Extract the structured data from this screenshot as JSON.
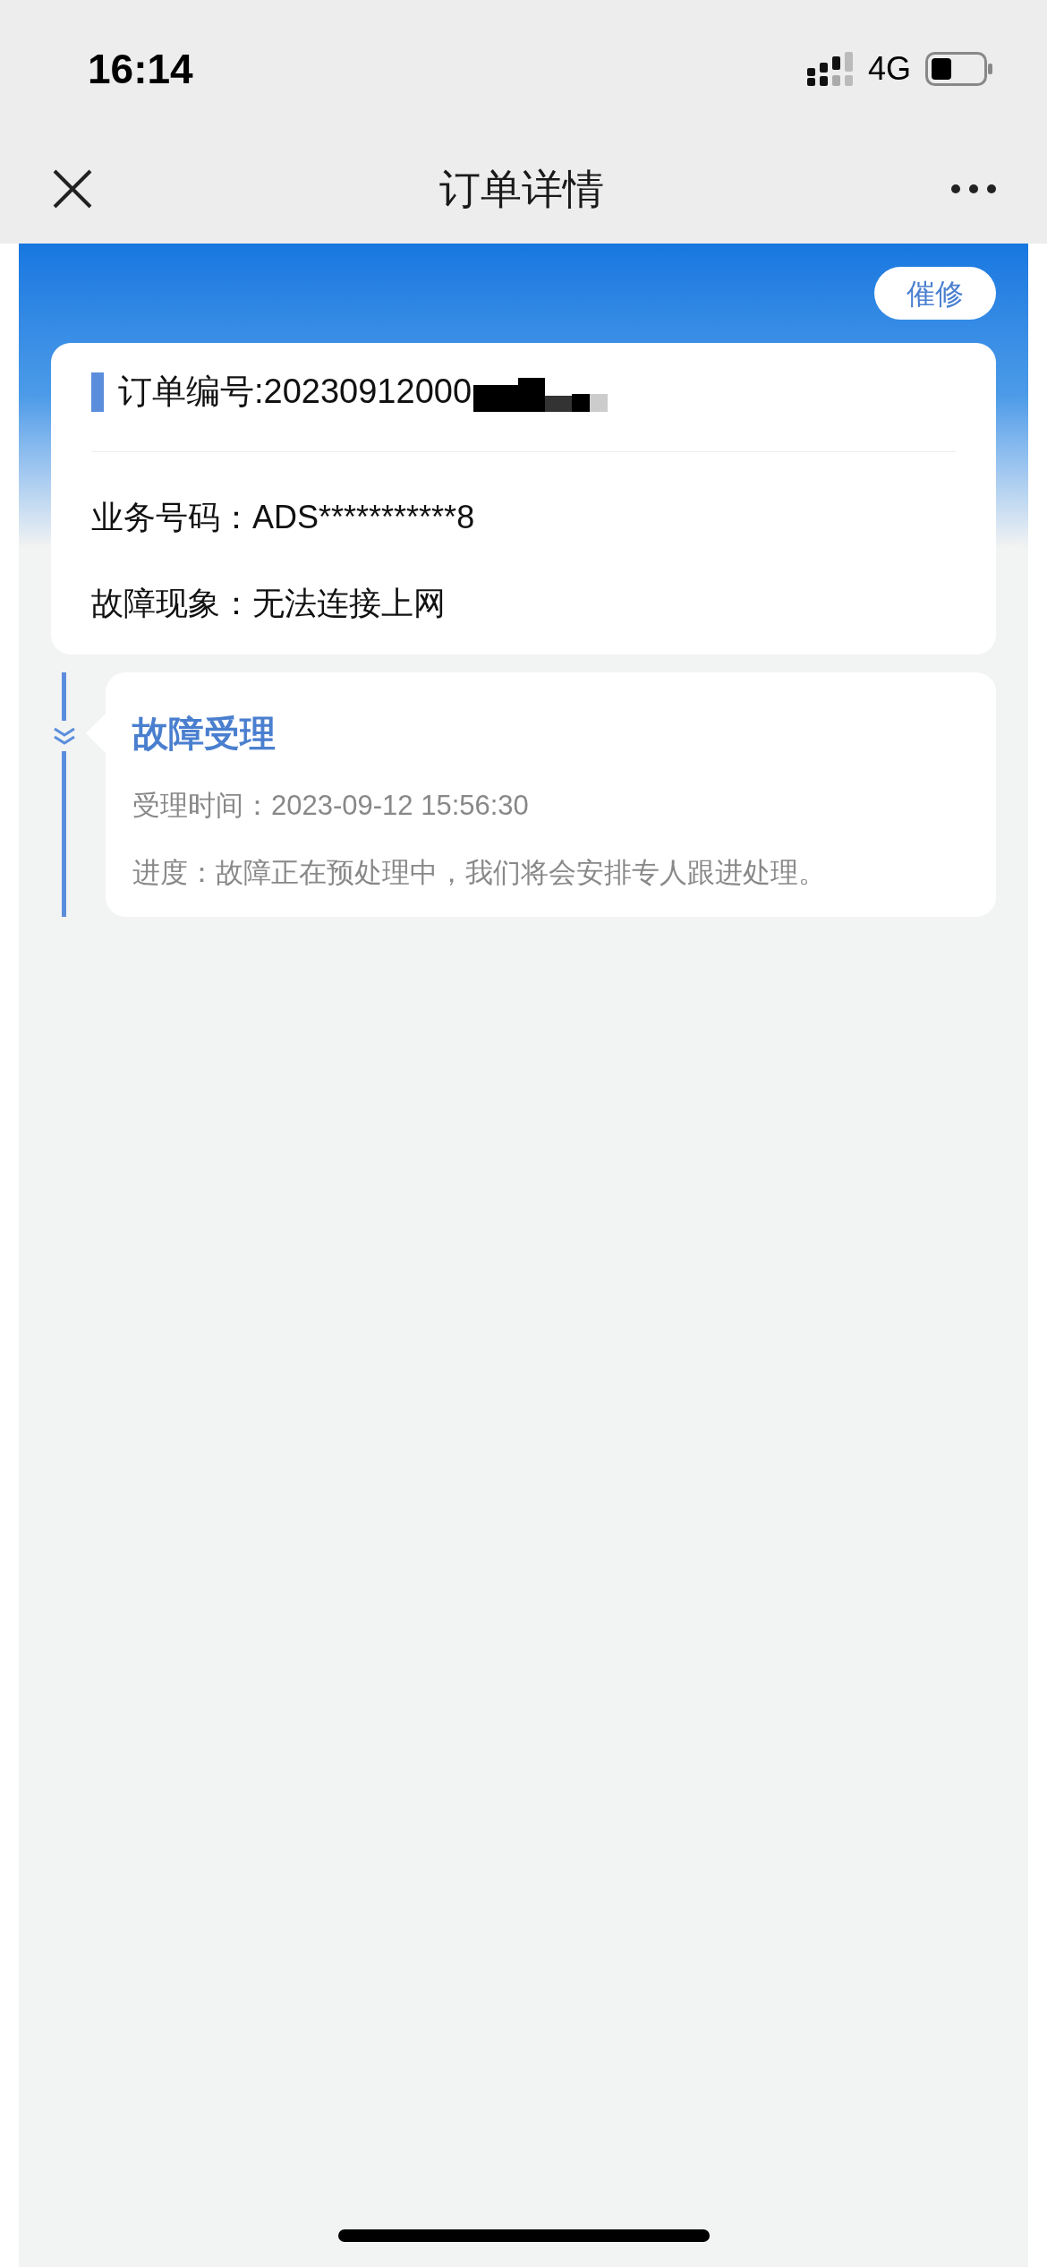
{
  "status_bar": {
    "time": "16:14",
    "network": "4G"
  },
  "nav_bar": {
    "title": "订单详情"
  },
  "urge_button": "催修",
  "order_card": {
    "order_number": "订单编号:20230912000",
    "fields": [
      {
        "label": "业务号码：",
        "value": "ADS***********8"
      },
      {
        "label": "故障现象：",
        "value": "无法连接上网"
      }
    ]
  },
  "timeline": [
    {
      "title": "故障受理",
      "time": "受理时间：2023-09-12 15:56:30",
      "progress": "进度：故障正在预处理中，我们将会安排专人跟进处理。"
    }
  ]
}
